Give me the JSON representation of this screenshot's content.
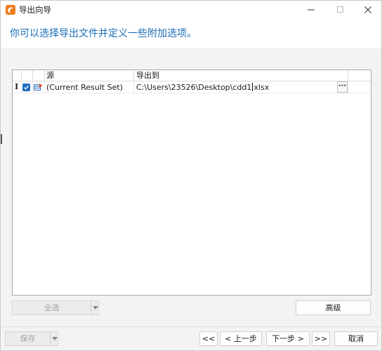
{
  "window": {
    "title": "导出向导"
  },
  "header": {
    "heading": "你可以选择导出文件并定义一些附加选项。"
  },
  "grid": {
    "columns": [
      "源",
      "导出到"
    ],
    "rows": [
      {
        "indicator": "I",
        "checked": true,
        "source": "(Current Result Set)",
        "destination_before_caret": "C:\\Users\\23526\\Desktop\\cdd1",
        "destination_after_caret": "xlsx",
        "ellipsis": "···"
      }
    ]
  },
  "actions": {
    "select_all_label": "全选",
    "advanced_label": "高级"
  },
  "footer": {
    "save_label": "保存",
    "first_label": "<<",
    "prev_label": "< 上一步",
    "next_label": "下一步 >",
    "last_label": ">>",
    "cancel_label": "取消"
  },
  "colors": {
    "accent": "#1a6db5",
    "checkbox": "#1f6fc1"
  }
}
